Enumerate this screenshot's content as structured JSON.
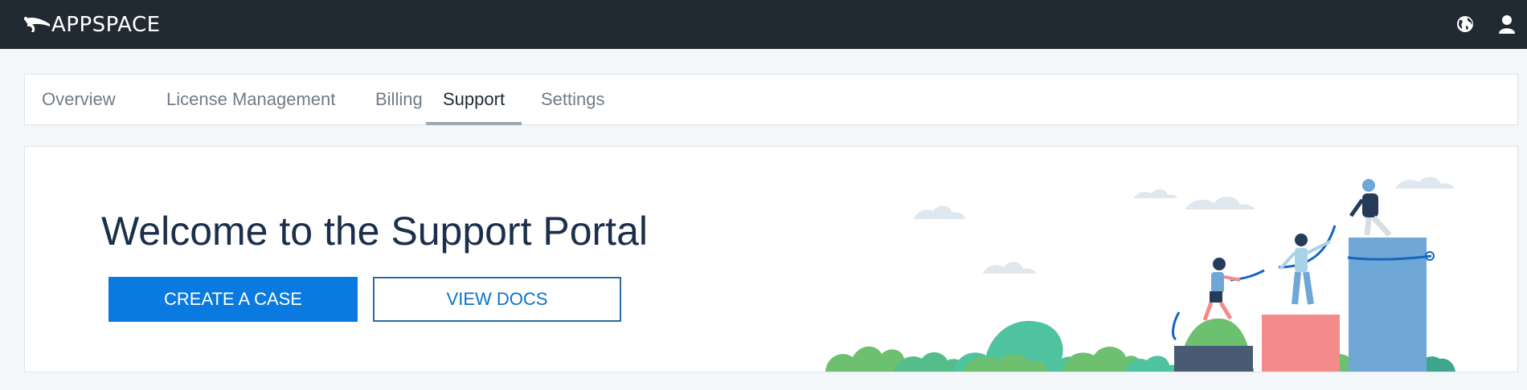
{
  "header": {
    "brand": "APPSPACE",
    "background_color": "#212a33",
    "icons": [
      "globe-icon",
      "user-icon"
    ]
  },
  "tabs": [
    {
      "label": "Overview",
      "active": false
    },
    {
      "label": "License Management",
      "active": false
    },
    {
      "label": "Billing",
      "active": false
    },
    {
      "label": "Support",
      "active": true
    },
    {
      "label": "Settings",
      "active": false
    }
  ],
  "main": {
    "title": "Welcome to the Support Portal",
    "create_case_label": "CREATE A CASE",
    "view_docs_label": "VIEW DOCS",
    "primary_color": "#0a79e0"
  }
}
